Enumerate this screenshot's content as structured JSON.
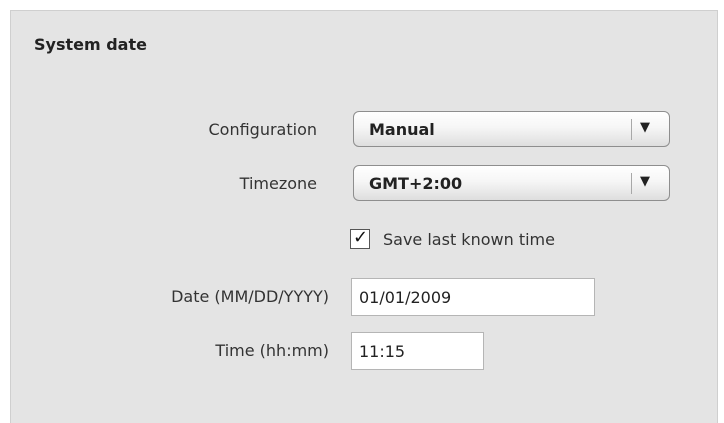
{
  "section": {
    "title": "System date"
  },
  "configuration": {
    "label": "Configuration",
    "value": "Manual",
    "arrow": "▼",
    "arrow_icon": "triangle-down-icon"
  },
  "timezone": {
    "label": "Timezone",
    "value": "GMT+2:00",
    "arrow": "▼",
    "arrow_icon": "triangle-down-icon"
  },
  "save_time": {
    "label": "Save last known time",
    "checked": true,
    "mark": "✓",
    "mark_icon": "checkmark-icon"
  },
  "date": {
    "label": "Date (MM/DD/YYYY)",
    "value": "01/01/2009"
  },
  "time": {
    "label": "Time (hh:mm)",
    "value": "11:15"
  }
}
